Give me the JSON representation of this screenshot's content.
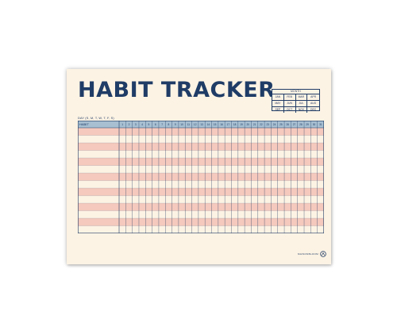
{
  "title": "HABIT TRACKER",
  "month_box": {
    "title": "MONTH",
    "months": [
      "JAN",
      "FEB",
      "MAR",
      "APR",
      "MAY",
      "JUN",
      "JUL",
      "AUG",
      "SEP",
      "OCT",
      "NOV",
      "DEC"
    ]
  },
  "day_label": "DAY (S, M, T, W, T, F, S)",
  "tracker": {
    "habit_header": "HABIT",
    "days": [
      "1",
      "2",
      "3",
      "4",
      "5",
      "6",
      "7",
      "8",
      "9",
      "10",
      "11",
      "12",
      "13",
      "14",
      "15",
      "16",
      "17",
      "18",
      "19",
      "20",
      "21",
      "22",
      "23",
      "24",
      "25",
      "26",
      "27",
      "28",
      "29",
      "30",
      "31"
    ],
    "habit_row_count": 14,
    "colors": {
      "header_fill": "#a7bfd1",
      "stripe_pink": "#f5c9bd",
      "stripe_cream": "#fdf3e4",
      "line": "#1f3c66"
    }
  },
  "brand": {
    "text": "MAISONBLOOM",
    "icon": "circle-logo-icon"
  }
}
